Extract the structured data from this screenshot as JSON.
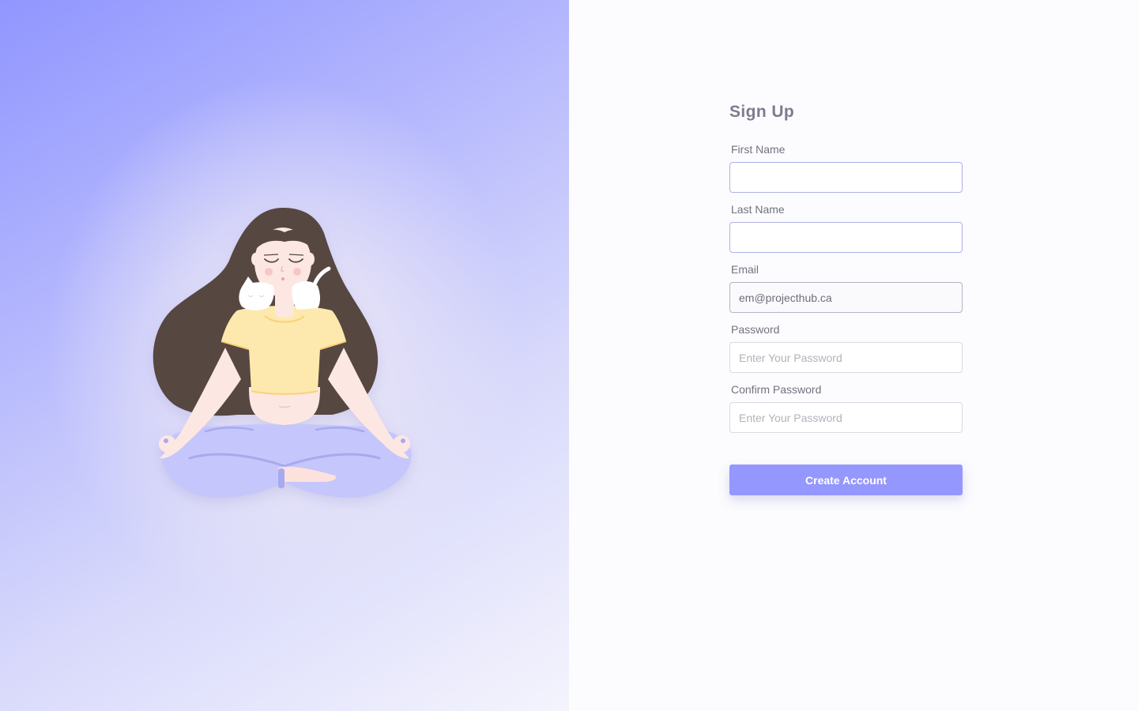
{
  "illustration": {
    "icon": "meditating-woman-with-cat-illustration"
  },
  "form": {
    "title": "Sign Up",
    "fields": [
      {
        "label": "First Name",
        "value": "",
        "placeholder": ""
      },
      {
        "label": "Last Name",
        "value": "",
        "placeholder": ""
      },
      {
        "label": "Email",
        "value": "em@projecthub.ca",
        "placeholder": ""
      },
      {
        "label": "Password",
        "value": "",
        "placeholder": "Enter Your Password"
      },
      {
        "label": "Confirm Password",
        "value": "",
        "placeholder": "Enter Your Password"
      }
    ],
    "submit_label": "Create Account"
  },
  "colors": {
    "accent": "#9497fe",
    "label_text": "#727280",
    "title_text": "#7c7c90"
  }
}
